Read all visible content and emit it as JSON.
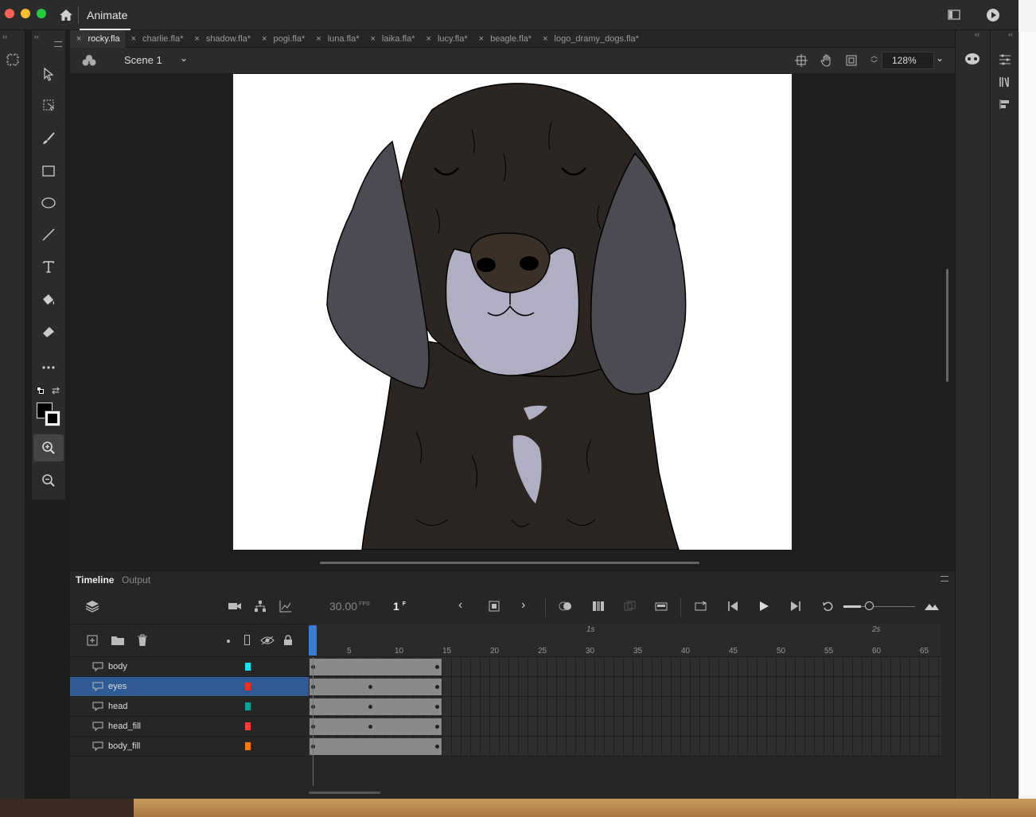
{
  "app": {
    "title": "Animate"
  },
  "tabs": [
    "rocky.fla",
    "charlie.fla*",
    "shadow.fla*",
    "pogi.fla*",
    "luna.fla*",
    "laika.fla*",
    "lucy.fla*",
    "beagle.fla*",
    "logo_dramy_dogs.fla*"
  ],
  "scene": {
    "label": "Scene 1",
    "zoom": "128%"
  },
  "timeline": {
    "tab_timeline": "Timeline",
    "tab_output": "Output",
    "fps": "30.00",
    "fps_unit": "FPS",
    "frame": "1",
    "frame_unit": "F",
    "ruler_ticks": [
      "5",
      "10",
      "15",
      "20",
      "25",
      "30",
      "35",
      "40",
      "45",
      "50",
      "55",
      "60",
      "65"
    ],
    "ruler_seconds": [
      "1s",
      "2s"
    ],
    "layers": [
      {
        "name": "body",
        "color": "#19e3f0",
        "selected": false
      },
      {
        "name": "eyes",
        "color": "#ff2a1e",
        "selected": true
      },
      {
        "name": "head",
        "color": "#0aa39a",
        "selected": false
      },
      {
        "name": "head_fill",
        "color": "#ff3b3b",
        "selected": false
      },
      {
        "name": "body_fill",
        "color": "#ff7b10",
        "selected": false
      }
    ]
  },
  "colors": {
    "accent": "#2f5a94",
    "playhead": "#3a7bd5"
  }
}
